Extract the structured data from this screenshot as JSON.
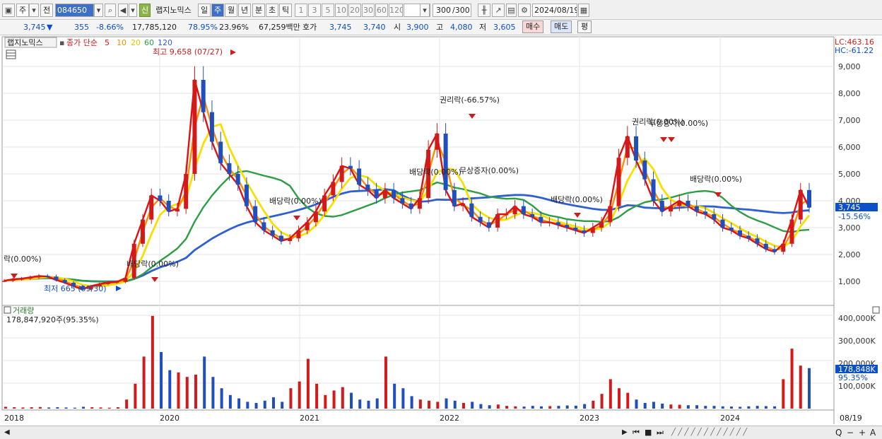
{
  "toolbar": {
    "period_ju": "주",
    "jeon": "전",
    "code": "084650",
    "shin": "신",
    "name": "랩지노믹스",
    "day": "일",
    "week": "주",
    "month": "월",
    "year": "년",
    "minute": "분",
    "second": "초",
    "tick": "틱",
    "intervals": [
      "1",
      "3",
      "5",
      "10",
      "20",
      "30",
      "60",
      "120"
    ],
    "count": "300",
    "count_total": "/300",
    "date": "2024/08/19"
  },
  "quote": {
    "price": "3,745",
    "change": "355",
    "change_pct": "-8.66%",
    "volume": "17,785,120",
    "vol_ratio": "78.95%",
    "turnover": "23.96%",
    "amount": "67,259백만",
    "hoga_label": "호가",
    "hoga1": "3,745",
    "hoga2": "3,740",
    "open_label": "시",
    "open": "3,900",
    "high_label": "고",
    "high": "4,080",
    "low_label": "저",
    "low": "3,605",
    "buy": "매수",
    "sell": "매도",
    "pyeong": "평"
  },
  "price_panel": {
    "legend_name": "랩지노믹스",
    "legend_ma": "종가 단순",
    "ma_periods": [
      "5",
      "10",
      "20",
      "60",
      "120"
    ],
    "ma_colors": [
      "#e01010",
      "#ff8c00",
      "#f5e000",
      "#2e9e44",
      "#2f5fd0"
    ],
    "lc": "LC:463.16",
    "hc": "HC:-61.22",
    "current_price_tag": "3,745",
    "current_pct_tag": "-15.56%",
    "y_ticks": [
      "9,000",
      "8,000",
      "7,000",
      "6,000",
      "5,000",
      "4,000",
      "3,000",
      "2,000",
      "1,000"
    ],
    "annotations": {
      "high": "최고 9,658 (07/27)",
      "low": "최저 665 (09/30)",
      "div_2018": "락(0.00%)",
      "div_2019": "배당락(0.00%)",
      "div_2020": "배당락(0.00%)",
      "rights_2022": "권리락(-66.57%)",
      "div_2022": "배당락(0.00%)",
      "bonus_2022": "무상증자(0.00%)",
      "div_2023a": "배당락(0.00%)",
      "rights_2023": "권리락(0.00%)",
      "bonus_2023": "무상증자(0.00%)",
      "div_2023b": "배당락(0.00%)"
    },
    "close_series": [
      1020,
      1080,
      1100,
      1150,
      1200,
      1180,
      1050,
      950,
      820,
      700,
      820,
      900,
      960,
      980,
      1120,
      2400,
      3300,
      4200,
      4000,
      3600,
      3700,
      5000,
      8500,
      7300,
      6200,
      5400,
      5000,
      4600,
      3800,
      3200,
      2900,
      2700,
      2500,
      2600,
      2900,
      3200,
      3600,
      4200,
      4700,
      5300,
      5200,
      4600,
      4400,
      4100,
      4400,
      4100,
      3900,
      3700,
      4100,
      5900,
      6500,
      4400,
      3800,
      3900,
      3400,
      3200,
      3000,
      3500,
      3500,
      3800,
      3500,
      3400,
      3200,
      3200,
      3100,
      3000,
      2900,
      2800,
      3000,
      3200,
      3800,
      5600,
      6400,
      5500,
      4800,
      4000,
      3600,
      3800,
      4000,
      3800,
      3600,
      3500,
      3300,
      3000,
      2900,
      2700,
      2600,
      2400,
      2200,
      2100,
      2400,
      3300,
      4400,
      3745
    ]
  },
  "volume_panel": {
    "title": "거래량",
    "value": "178,847,920주(95.35%)",
    "y_ticks": [
      "400,000K",
      "300,000K",
      "200,000K",
      "100,000K"
    ],
    "current_tag": "178,848K",
    "current_pct": "95.35%",
    "series": [
      8,
      6,
      5,
      6,
      7,
      5,
      6,
      5,
      4,
      8,
      6,
      5,
      4,
      6,
      40,
      110,
      230,
      410,
      250,
      170,
      160,
      140,
      150,
      230,
      140,
      90,
      60,
      45,
      30,
      25,
      35,
      50,
      30,
      90,
      120,
      220,
      110,
      60,
      80,
      95,
      70,
      40,
      35,
      45,
      230,
      110,
      90,
      55,
      40,
      35,
      30,
      45,
      35,
      25,
      30,
      20,
      15,
      18,
      12,
      10,
      9,
      12,
      10,
      11,
      12,
      14,
      13,
      20,
      35,
      65,
      130,
      90,
      70,
      40,
      25,
      30,
      22,
      18,
      17,
      15,
      15,
      12,
      12,
      10,
      9,
      8,
      10,
      12,
      11,
      10,
      130,
      265,
      190,
      179
    ]
  },
  "x_axis": [
    "2018",
    "2020",
    "2021",
    "2022",
    "2023",
    "2024",
    "08/19"
  ],
  "bottom_bar": {
    "left_arrow": "◀",
    "right_arrow": "▶",
    "zoom_text": "Q",
    "minus": "−",
    "plus": "+",
    "a": "A"
  }
}
